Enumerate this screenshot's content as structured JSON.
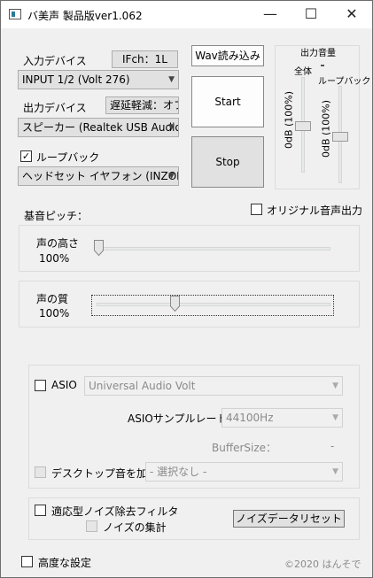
{
  "window": {
    "title": "バ美声 製品版ver1.062",
    "minimize_glyph": "—",
    "maximize_glyph": "☐",
    "close_glyph": "✕"
  },
  "input": {
    "label": "入力デバイス",
    "channel_button": "IFch：1L",
    "device": "INPUT 1/2 (Volt 276)"
  },
  "output": {
    "label": "出力デバイス",
    "latency_button": "遅延軽減：オフ",
    "device": "スピーカー (Realtek USB Audio)"
  },
  "loopback": {
    "label": "ループバック",
    "checked": true,
    "device": "ヘッドセット イヤフォン (INZONE Buds)"
  },
  "buttons": {
    "wav": "Wav読み込み",
    "start": "Start",
    "stop": "Stop"
  },
  "volume": {
    "title": "出力音量",
    "master_label": "全体",
    "loopback_label": "ループバック",
    "master_value": "0dB (100%)",
    "loopback_value": "0dB (100%)"
  },
  "pitch": {
    "section_label": "基音ピッチ：",
    "original_output_label": "オリジナル音声出力",
    "height_label": "声の高さ",
    "height_value": "100%",
    "height_fraction": 0.0,
    "quality_label": "声の質",
    "quality_value": "100%",
    "quality_fraction": 0.33
  },
  "asio": {
    "label": "ASIO",
    "device": "Universal Audio Volt",
    "samplerate_label": "ASIOサンプルレート：",
    "samplerate_value": "44100Hz",
    "buffersize_label": "BufferSize：",
    "buffersize_value": "-",
    "desktop_label": "デスクトップ音を加算",
    "desktop_value": "- 選択なし -"
  },
  "noise": {
    "filter_label": "適応型ノイズ除去フィルタ",
    "collect_label": "ノイズの集計",
    "reset_button": "ノイズデータリセット"
  },
  "footer": {
    "advanced_label": "高度な設定",
    "copyright": "©2020 はんそで"
  },
  "icons": {
    "dropdown": "chevron-down-icon",
    "check": "✓"
  }
}
